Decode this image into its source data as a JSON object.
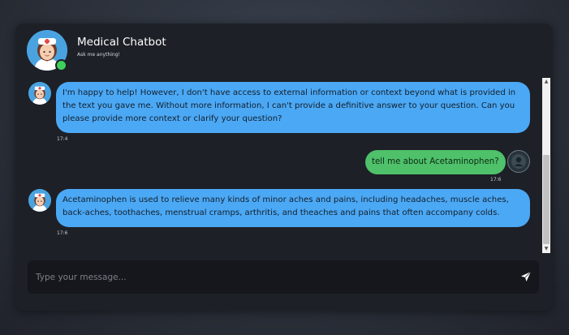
{
  "header": {
    "title": "Medical Chatbot",
    "subtitle": "Ask me anything!",
    "status": "online"
  },
  "messages": [
    {
      "sender": "bot",
      "text": "I'm happy to help! However, I don't have access to external information or context beyond what is provided in the text you gave me. Without more information, I can't provide a definitive answer to your question. Can you please provide more context or clarify your question?",
      "time": "17:4"
    },
    {
      "sender": "user",
      "text": "tell me about Acetaminophen?",
      "time": "17:6"
    },
    {
      "sender": "bot",
      "text": "Acetaminophen is used to relieve many kinds of minor aches and pains, including headaches, muscle aches, back-aches, toothaches, menstrual cramps, arthritis, and theaches and pains that often accompany colds.",
      "time": "17:6"
    }
  ],
  "input": {
    "placeholder": "Type your message..."
  },
  "icons": {
    "send": "send-icon",
    "bot_avatar": "nurse-avatar-icon",
    "user_avatar": "user-avatar-icon"
  },
  "colors": {
    "bot_bubble": "#4ba8f5",
    "user_bubble": "#4ec16a",
    "online": "#3fcf5b",
    "window_bg": "#1d2027"
  }
}
